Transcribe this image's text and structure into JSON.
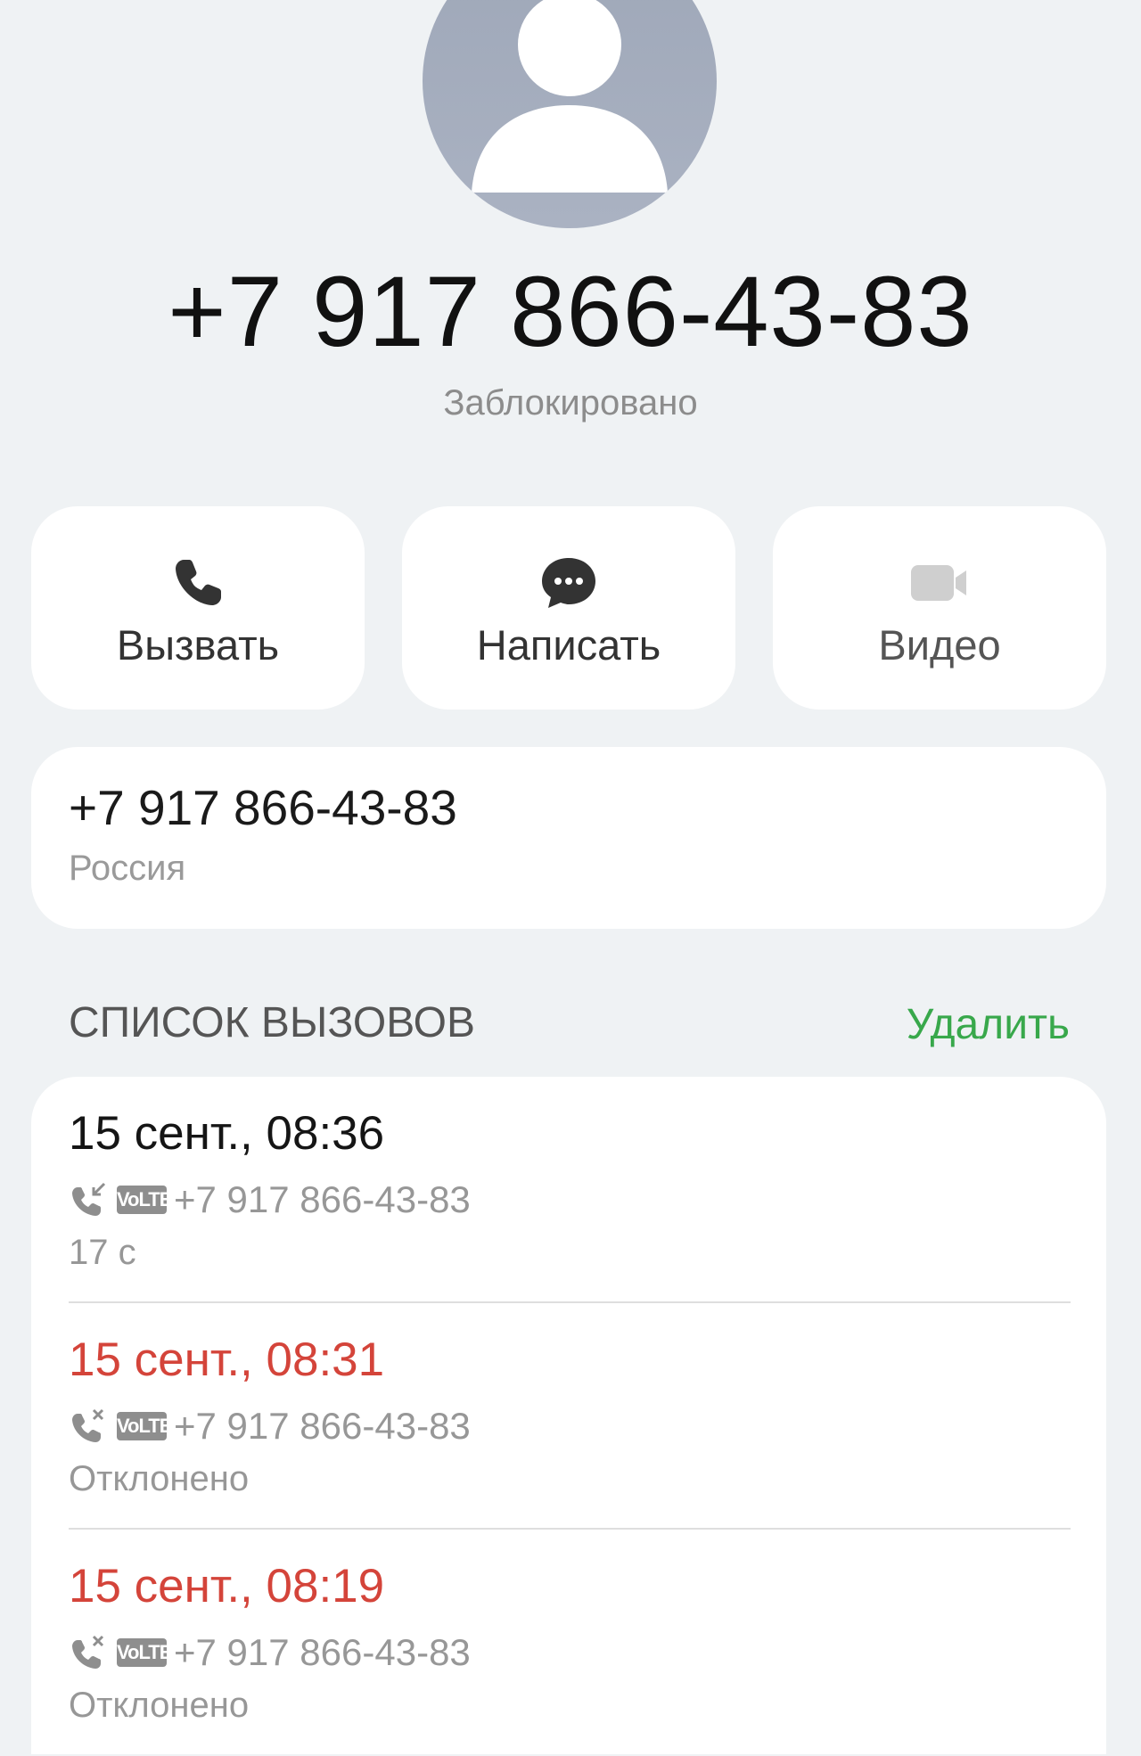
{
  "contact": {
    "number": "+7 917 866-43-83",
    "status": "Заблокировано",
    "avatar_icon": "person-silhouette-icon"
  },
  "actions": [
    {
      "label": "Вызвать",
      "icon": "phone-icon",
      "color": "#333333"
    },
    {
      "label": "Написать",
      "icon": "chat-bubble-icon",
      "color": "#333333"
    },
    {
      "label": "Видео",
      "icon": "video-camera-icon",
      "color": "#cfcfcf"
    }
  ],
  "number_card": {
    "number": "+7 917 866-43-83",
    "region": "Россия"
  },
  "call_log": {
    "title": "СПИСОК ВЫЗОВОВ",
    "delete_label": "Удалить",
    "delete_color": "#38a84b",
    "missed_color": "#d4443a",
    "items": [
      {
        "when": "15 сент., 08:36",
        "type_icon": "incoming-call-icon",
        "badge": "VoLTE",
        "number": "+7 917 866-43-83",
        "detail": "17 с",
        "missed": false
      },
      {
        "when": "15 сент., 08:31",
        "type_icon": "rejected-call-icon",
        "badge": "VoLTE",
        "number": "+7 917 866-43-83",
        "detail": "Отклонено",
        "missed": true
      },
      {
        "when": "15 сент., 08:19",
        "type_icon": "rejected-call-icon",
        "badge": "VoLTE",
        "number": "+7 917 866-43-83",
        "detail": "Отклонено",
        "missed": true
      }
    ]
  }
}
